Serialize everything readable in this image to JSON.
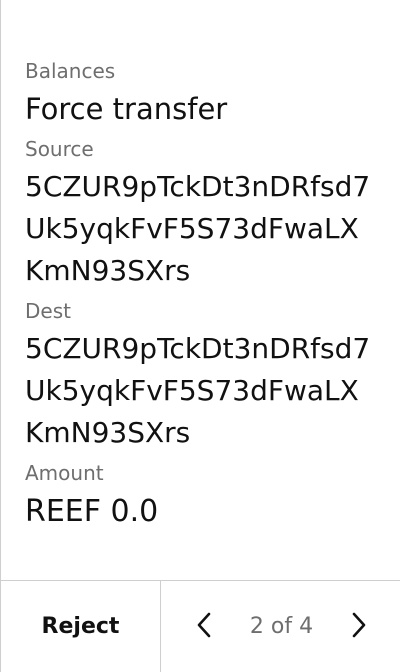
{
  "transaction": {
    "module": "Balances",
    "method": "Force transfer",
    "fields": [
      {
        "label": "Source",
        "value": "5CZUR9pTckDt3nDRfsd7Uk5yqkFvF5S73dFwaLXKmN93SXrs"
      },
      {
        "label": "Dest",
        "value": "5CZUR9pTckDt3nDRfsd7Uk5yqkFvF5S73dFwaLXKmN93SXrs"
      },
      {
        "label": "Amount",
        "value": "REEF 0.0"
      }
    ]
  },
  "footer": {
    "reject_label": "Reject",
    "page_indicator": "2 of 4",
    "prev_icon": "chevron-left-icon",
    "next_icon": "chevron-right-icon"
  }
}
